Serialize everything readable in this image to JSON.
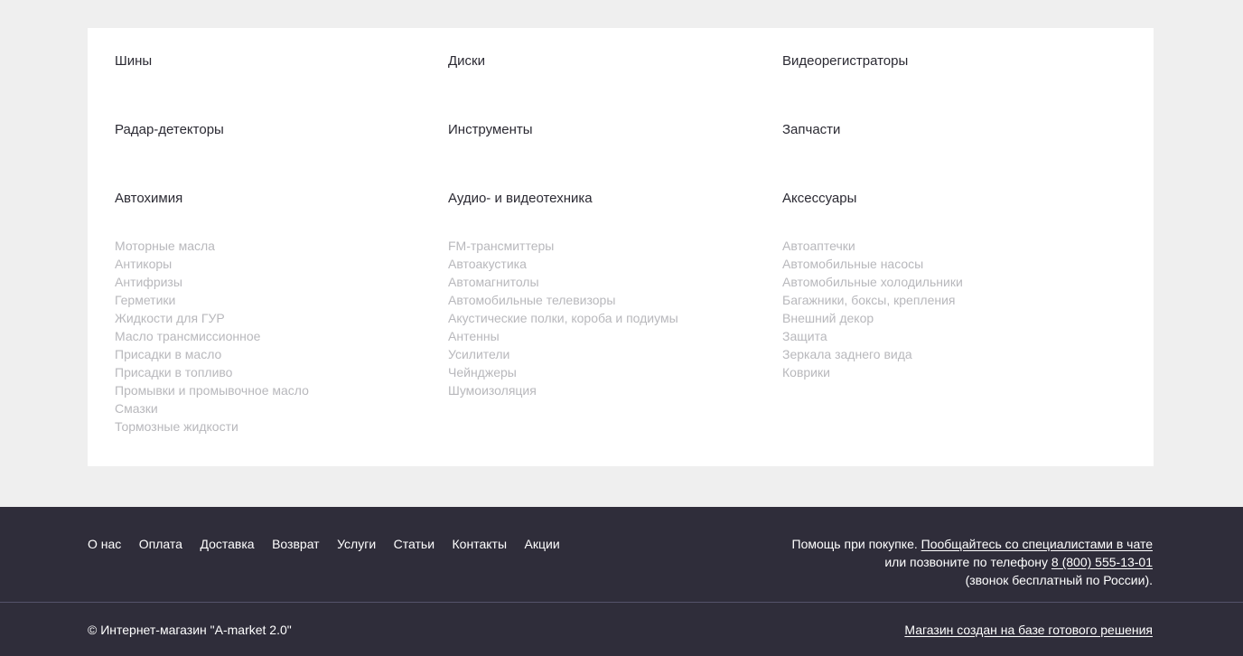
{
  "catalog": {
    "col1": {
      "row1": "Шины",
      "row2": "Радар-детекторы",
      "row3": "Автохимия",
      "items": [
        "Моторные масла",
        "Антикоры",
        "Антифризы",
        "Герметики",
        "Жидкости для ГУР",
        "Масло трансмиссионное",
        "Присадки в масло",
        "Присадки в топливо",
        "Промывки и промывочное масло",
        "Смазки",
        "Тормозные жидкости"
      ]
    },
    "col2": {
      "row1": "Диски",
      "row2": "Инструменты",
      "row3": "Аудио- и видеотехника",
      "items": [
        "FM-трансмиттеры",
        "Автоакустика",
        "Автомагнитолы",
        "Автомобильные телевизоры",
        "Акустические полки, короба и подиумы",
        "Антенны",
        "Усилители",
        "Чейнджеры",
        "Шумоизоляция"
      ]
    },
    "col3": {
      "row1": "Видеорегистраторы",
      "row2": "Запчасти",
      "row3": "Аксессуары",
      "items": [
        "Автоаптечки",
        "Автомобильные насосы",
        "Автомобильные холодильники",
        "Багажники, боксы, крепления",
        "Внешний декор",
        "Защита",
        "Зеркала заднего вида",
        "Коврики"
      ]
    }
  },
  "footer": {
    "nav": [
      "О нас",
      "Оплата",
      "Доставка",
      "Возврат",
      "Услуги",
      "Статьи",
      "Контакты",
      "Акции"
    ],
    "help_prefix": "Помощь при покупке.",
    "chat_link": "Пообщайтесь со специалистами в чате",
    "call_prefix": "или позвоните по телефону",
    "phone": "8 (800) 555-13-01",
    "free_call_note": "(звонок бесплатный по России).",
    "copyright": "© Интернет-магазин \"A-market 2.0\"",
    "built_on": "Магазин создан на базе готового решения"
  },
  "colors": {
    "page_bg": "#efefef",
    "panel_bg": "#ffffff",
    "footer_bg": "#2f2d3a",
    "category_text": "#2b2a33",
    "subcategory_text": "#b8b8bc"
  }
}
